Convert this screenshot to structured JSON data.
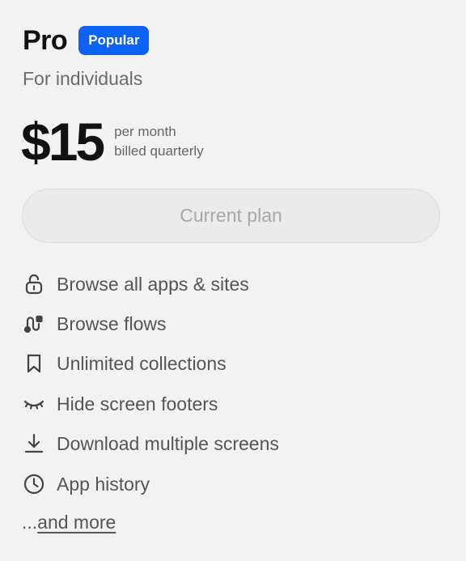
{
  "plan": {
    "name": "Pro",
    "badge": "Popular",
    "subtitle": "For individuals",
    "price": "$15",
    "period_line1": "per month",
    "period_line2": "billed quarterly",
    "button_label": "Current plan"
  },
  "features": [
    {
      "icon": "unlock-icon",
      "label": "Browse all apps & sites"
    },
    {
      "icon": "flow-icon",
      "label": "Browse flows"
    },
    {
      "icon": "bookmark-icon",
      "label": "Unlimited collections"
    },
    {
      "icon": "eye-closed-icon",
      "label": "Hide screen footers"
    },
    {
      "icon": "download-icon",
      "label": "Download multiple screens"
    },
    {
      "icon": "clock-icon",
      "label": "App history"
    }
  ],
  "more": {
    "prefix": "...",
    "link_label": "and more"
  },
  "colors": {
    "background": "#f2f2f2",
    "badge": "#0b63f6",
    "button_bg": "#ebebeb",
    "button_text": "#a8a8a8"
  }
}
